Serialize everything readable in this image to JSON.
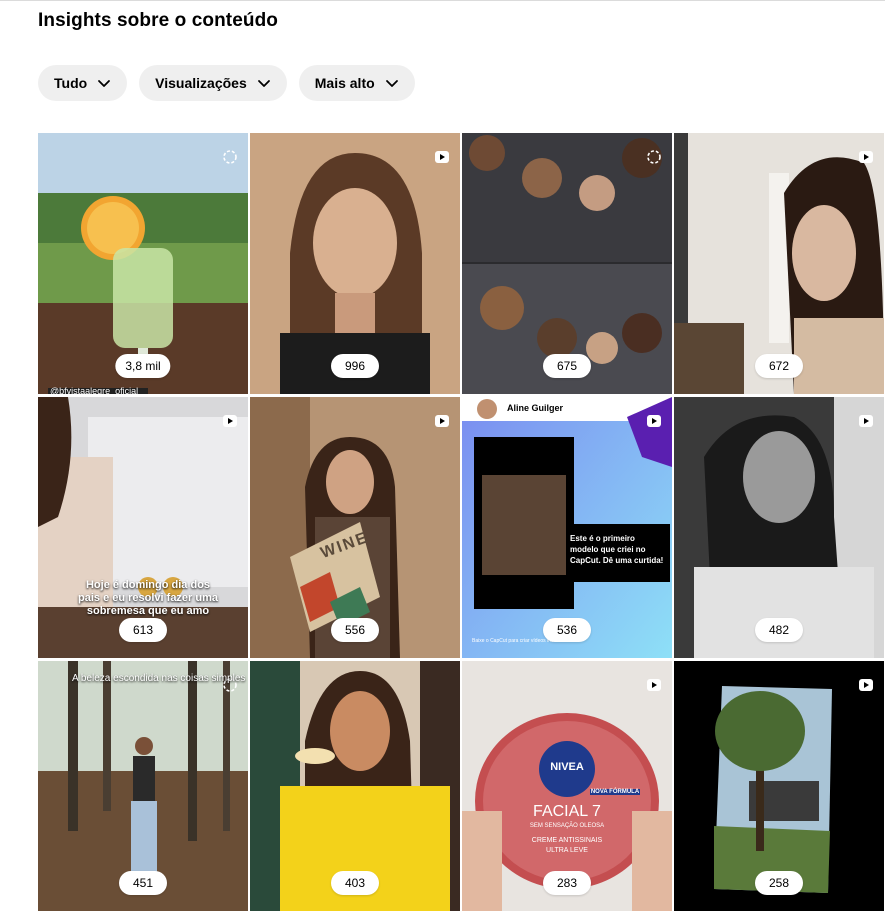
{
  "page": {
    "title": "Insights sobre o conteúdo"
  },
  "filters": [
    {
      "label": "Tudo"
    },
    {
      "label": "Visualizações"
    },
    {
      "label": "Mais alto"
    }
  ],
  "posts": [
    {
      "views": "3,8 mil",
      "type": "carousel",
      "subject": "caipirinha drink outdoors",
      "caption": "@bfvistaalegre_oficial"
    },
    {
      "views": "996",
      "type": "reel",
      "subject": "woman portrait selfie"
    },
    {
      "views": "675",
      "type": "carousel",
      "subject": "group selfie collage"
    },
    {
      "views": "672",
      "type": "reel",
      "subject": "woman profile indoors"
    },
    {
      "views": "613",
      "type": "reel",
      "subject": "woman at table",
      "caption": "Hoje é domingo dia dos pais e eu resolvi fazer uma sobremesa que eu amo que é"
    },
    {
      "views": "556",
      "type": "reel",
      "subject": "woman holding wine box",
      "box_text": "WINE"
    },
    {
      "views": "536",
      "type": "reel",
      "subject": "CapCut template",
      "author": "Aline Guilger",
      "caption": "Este é o primeiro modelo que criei no CapCut. Dê uma curtida!",
      "footer": "Baixe o CapCut para criar vídeos incríveis"
    },
    {
      "views": "482",
      "type": "reel",
      "subject": "black and white portrait"
    },
    {
      "views": "451",
      "type": "carousel",
      "subject": "woman in forest",
      "caption": "A beleza escondida nas coisas simples"
    },
    {
      "views": "403",
      "type": "reel",
      "subject": "woman in Brazil jersey with drink"
    },
    {
      "views": "283",
      "type": "reel",
      "subject": "Nivea cream jar",
      "product": {
        "brand": "NIVEA",
        "name": "FACIAL 7",
        "sub": "SEM SENSAÇÃO OLEOSA",
        "line1": "CREME ANTISSINAIS",
        "line2": "ULTRA LEVE",
        "tag": "NOVA FÓRMULA"
      }
    },
    {
      "views": "258",
      "type": "reel",
      "subject": "tree and house video"
    }
  ],
  "colors": {
    "pill_bg": "#efefef",
    "badge_white": "#ffffff"
  }
}
